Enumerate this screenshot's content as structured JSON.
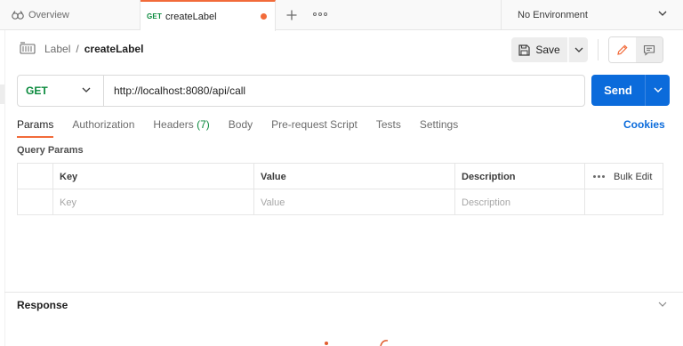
{
  "tabs": {
    "overview_label": "Overview",
    "active": {
      "method": "GET",
      "name": "createLabel"
    }
  },
  "environment": {
    "selected": "No Environment"
  },
  "breadcrumb": {
    "parent": "Label",
    "separator": "/",
    "current": "createLabel"
  },
  "toolbar": {
    "save_label": "Save"
  },
  "request": {
    "method": "GET",
    "url": "http://localhost:8080/api/call",
    "send_label": "Send"
  },
  "request_tabs": [
    {
      "label": "Params",
      "count": ""
    },
    {
      "label": "Authorization",
      "count": ""
    },
    {
      "label": "Headers",
      "count": "(7)"
    },
    {
      "label": "Body",
      "count": ""
    },
    {
      "label": "Pre-request Script",
      "count": ""
    },
    {
      "label": "Tests",
      "count": ""
    },
    {
      "label": "Settings",
      "count": ""
    }
  ],
  "cookies_label": "Cookies",
  "query_params": {
    "title": "Query Params",
    "columns": [
      "Key",
      "Value",
      "Description"
    ],
    "bulk_edit_label": "Bulk Edit",
    "placeholders": {
      "key": "Key",
      "value": "Value",
      "description": "Description"
    }
  },
  "response": {
    "title": "Response"
  },
  "colors": {
    "accent": "#f26b3a",
    "primary": "#0b6bdb",
    "get_method": "#0a8a3d"
  }
}
